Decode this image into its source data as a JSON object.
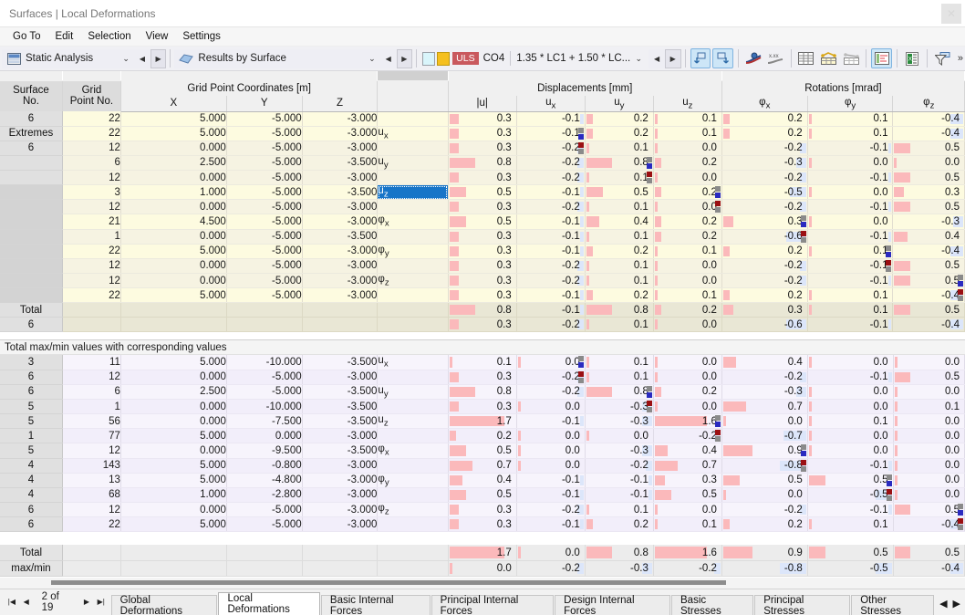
{
  "window": {
    "title": "Surfaces | Local Deformations",
    "close_label": "✕"
  },
  "menu": {
    "items": [
      {
        "label": "Go To"
      },
      {
        "label": "Edit"
      },
      {
        "label": "Selection"
      },
      {
        "label": "View"
      },
      {
        "label": "Settings"
      }
    ]
  },
  "toolbar": {
    "analysis_combo": {
      "value": "Static Analysis",
      "icon": "analysis-icon",
      "chevron": "⌄"
    },
    "results_combo": {
      "value": "Results by Surface",
      "icon": "surface-icon",
      "chevron": "⌄"
    },
    "prev_label": "◀",
    "next_label": "▶",
    "load_case": {
      "badge": "ULS",
      "code": "CO4",
      "formula": "1.35 * LC1 + 1.50 * LC...",
      "chevron": "⌄"
    },
    "buttons": [
      {
        "name": "rotate-left-button",
        "active": true
      },
      {
        "name": "rotate-right-button",
        "active": true
      },
      {
        "name": "result-diagram-button",
        "active": false
      },
      {
        "name": "numeric-values-button",
        "active": false
      },
      {
        "name": "table-view-button",
        "active": false
      },
      {
        "name": "table-highlight-button",
        "active": false
      },
      {
        "name": "table-plain-button",
        "active": false
      },
      {
        "name": "color-bars-button",
        "active": true
      },
      {
        "name": "export-excel-button",
        "active": false
      },
      {
        "name": "filter-button",
        "active": false
      }
    ],
    "overflow_label": "»"
  },
  "table": {
    "group_headers": [
      {
        "label": "",
        "span": 1
      },
      {
        "label": "",
        "span": 1
      },
      {
        "label": "Grid Point Coordinates [m]",
        "span": 3
      },
      {
        "label": "",
        "span": 1
      },
      {
        "label": "Displacements [mm]",
        "span": 4
      },
      {
        "label": "Rotations [mrad]",
        "span": 3
      }
    ],
    "columns": [
      {
        "key": "surface_no",
        "label_line1": "Surface",
        "label_line2": "No."
      },
      {
        "key": "grid_point_no",
        "label_line1": "Grid",
        "label_line2": "Point No."
      },
      {
        "key": "x",
        "label_line1": "",
        "label_line2": "X"
      },
      {
        "key": "y",
        "label_line1": "",
        "label_line2": "Y"
      },
      {
        "key": "z",
        "label_line1": "",
        "label_line2": "Z"
      },
      {
        "key": "symbol",
        "label_line1": "",
        "label_line2": ""
      },
      {
        "key": "u_abs",
        "label_line1": "",
        "label_line2": "|u|"
      },
      {
        "key": "ux",
        "label_line1": "",
        "label_line2": "u_x"
      },
      {
        "key": "uy",
        "label_line1": "",
        "label_line2": "u_y"
      },
      {
        "key": "uz",
        "label_line1": "",
        "label_line2": "u_z"
      },
      {
        "key": "phix",
        "label_line1": "",
        "label_line2": "φ_x"
      },
      {
        "key": "phiy",
        "label_line1": "",
        "label_line2": "φ_y"
      },
      {
        "key": "phiz",
        "label_line1": "",
        "label_line2": "φ_z"
      }
    ],
    "upper_row_header": {
      "line1": "6",
      "line2": "Extremes",
      "line3": "6"
    },
    "upper_rows": [
      {
        "rowhdr": "6",
        "grid": "22",
        "x": "5.000",
        "y": "-5.000",
        "z": "-3.000",
        "sym": "",
        "u_abs": "0.3",
        "ux": "-0.1",
        "uy": "0.2",
        "uz": "0.1",
        "phix": "0.2",
        "phiy": "0.1",
        "phiz": "-0.4",
        "tint": "A"
      },
      {
        "rowhdr": "Extremes",
        "grid": "22",
        "x": "5.000",
        "y": "-5.000",
        "z": "-3.000",
        "sym": "u_x",
        "u_abs": "0.3",
        "ux": "-0.1",
        "uy": "0.2",
        "uz": "0.1",
        "phix": "0.2",
        "phiy": "0.1",
        "phiz": "-0.4",
        "tint": "A"
      },
      {
        "rowhdr": "6",
        "grid": "12",
        "x": "0.000",
        "y": "-5.000",
        "z": "-3.000",
        "sym": "",
        "u_abs": "0.3",
        "ux": "-0.2",
        "uy": "0.1",
        "uz": "0.0",
        "phix": "-0.2",
        "phiy": "-0.1",
        "phiz": "0.5",
        "tint": "B"
      },
      {
        "rowhdr": "",
        "grid": "6",
        "x": "2.500",
        "y": "-5.000",
        "z": "-3.500",
        "sym": "u_y",
        "u_abs": "0.8",
        "ux": "-0.2",
        "uy": "0.8",
        "uz": "0.2",
        "phix": "-0.3",
        "phiy": "0.0",
        "phiz": "0.0",
        "tint": "B"
      },
      {
        "rowhdr": "",
        "grid": "12",
        "x": "0.000",
        "y": "-5.000",
        "z": "-3.000",
        "sym": "",
        "u_abs": "0.3",
        "ux": "-0.2",
        "uy": "0.1",
        "uz": "0.0",
        "phix": "-0.2",
        "phiy": "-0.1",
        "phiz": "0.5",
        "tint": "B"
      },
      {
        "rowhdr": "",
        "grid": "3",
        "x": "1.000",
        "y": "-5.000",
        "z": "-3.500",
        "sym": "u_z",
        "u_abs": "0.5",
        "ux": "-0.1",
        "uy": "0.5",
        "uz": "0.2",
        "phix": "-0.5",
        "phiy": "0.0",
        "phiz": "0.3",
        "tint": "A",
        "selected": true
      },
      {
        "rowhdr": "",
        "grid": "12",
        "x": "0.000",
        "y": "-5.000",
        "z": "-3.000",
        "sym": "",
        "u_abs": "0.3",
        "ux": "-0.2",
        "uy": "0.1",
        "uz": "0.0",
        "phix": "-0.2",
        "phiy": "-0.1",
        "phiz": "0.5",
        "tint": "B"
      },
      {
        "rowhdr": "",
        "grid": "21",
        "x": "4.500",
        "y": "-5.000",
        "z": "-3.000",
        "sym": "φ_x",
        "u_abs": "0.5",
        "ux": "-0.1",
        "uy": "0.4",
        "uz": "0.2",
        "phix": "0.3",
        "phiy": "0.0",
        "phiz": "-0.3",
        "tint": "A"
      },
      {
        "rowhdr": "",
        "grid": "1",
        "x": "0.000",
        "y": "-5.000",
        "z": "-3.500",
        "sym": "",
        "u_abs": "0.3",
        "ux": "-0.1",
        "uy": "0.1",
        "uz": "0.2",
        "phix": "-0.6",
        "phiy": "-0.1",
        "phiz": "0.4",
        "tint": "B"
      },
      {
        "rowhdr": "",
        "grid": "22",
        "x": "5.000",
        "y": "-5.000",
        "z": "-3.000",
        "sym": "φ_y",
        "u_abs": "0.3",
        "ux": "-0.1",
        "uy": "0.2",
        "uz": "0.1",
        "phix": "0.2",
        "phiy": "0.1",
        "phiz": "-0.4",
        "tint": "A"
      },
      {
        "rowhdr": "",
        "grid": "12",
        "x": "0.000",
        "y": "-5.000",
        "z": "-3.000",
        "sym": "",
        "u_abs": "0.3",
        "ux": "-0.2",
        "uy": "0.1",
        "uz": "0.0",
        "phix": "-0.2",
        "phiy": "-0.1",
        "phiz": "0.5",
        "tint": "B"
      },
      {
        "rowhdr": "",
        "grid": "12",
        "x": "0.000",
        "y": "-5.000",
        "z": "-3.000",
        "sym": "φ_z",
        "u_abs": "0.3",
        "ux": "-0.2",
        "uy": "0.1",
        "uz": "0.0",
        "phix": "-0.2",
        "phiy": "-0.1",
        "phiz": "0.5",
        "tint": "B"
      },
      {
        "rowhdr": "",
        "grid": "22",
        "x": "5.000",
        "y": "-5.000",
        "z": "-3.000",
        "sym": "",
        "u_abs": "0.3",
        "ux": "-0.1",
        "uy": "0.2",
        "uz": "0.1",
        "phix": "0.2",
        "phiy": "0.1",
        "phiz": "-0.4",
        "tint": "A"
      }
    ],
    "upper_totals": {
      "label_line1": "Total",
      "label_line2": "6",
      "max": {
        "u_abs": "0.8",
        "ux": "-0.1",
        "uy": "0.8",
        "uz": "0.2",
        "phix": "0.3",
        "phiy": "0.1",
        "phiz": "0.5"
      },
      "min": {
        "u_abs": "0.3",
        "ux": "-0.2",
        "uy": "0.1",
        "uz": "0.0",
        "phix": "-0.6",
        "phiy": "-0.1",
        "phiz": "-0.4"
      }
    },
    "lower_caption": "Total max/min values with corresponding values",
    "lower_rows": [
      {
        "rowhdr": "3",
        "grid": "11",
        "x": "5.000",
        "y": "-10.000",
        "z": "-3.500",
        "sym": "u_x",
        "u_abs": "0.1",
        "ux": "0.0",
        "uy": "0.1",
        "uz": "0.0",
        "phix": "0.4",
        "phiy": "0.0",
        "phiz": "0.0"
      },
      {
        "rowhdr": "6",
        "grid": "12",
        "x": "0.000",
        "y": "-5.000",
        "z": "-3.000",
        "sym": "",
        "u_abs": "0.3",
        "ux": "-0.2",
        "uy": "0.1",
        "uz": "0.0",
        "phix": "-0.2",
        "phiy": "-0.1",
        "phiz": "0.5"
      },
      {
        "rowhdr": "6",
        "grid": "6",
        "x": "2.500",
        "y": "-5.000",
        "z": "-3.500",
        "sym": "u_y",
        "u_abs": "0.8",
        "ux": "-0.2",
        "uy": "0.8",
        "uz": "0.2",
        "phix": "-0.3",
        "phiy": "0.0",
        "phiz": "0.0"
      },
      {
        "rowhdr": "5",
        "grid": "1",
        "x": "0.000",
        "y": "-10.000",
        "z": "-3.500",
        "sym": "",
        "u_abs": "0.3",
        "ux": "0.0",
        "uy": "-0.3",
        "uz": "0.0",
        "phix": "0.7",
        "phiy": "0.0",
        "phiz": "0.1"
      },
      {
        "rowhdr": "5",
        "grid": "56",
        "x": "0.000",
        "y": "-7.500",
        "z": "-3.500",
        "sym": "u_z",
        "u_abs": "1.7",
        "ux": "-0.1",
        "uy": "-0.3",
        "uz": "1.6",
        "phix": "0.0",
        "phiy": "0.1",
        "phiz": "0.0"
      },
      {
        "rowhdr": "1",
        "grid": "77",
        "x": "5.000",
        "y": "0.000",
        "z": "-3.000",
        "sym": "",
        "u_abs": "0.2",
        "ux": "0.0",
        "uy": "0.0",
        "uz": "-0.2",
        "phix": "-0.7",
        "phiy": "0.0",
        "phiz": "0.0"
      },
      {
        "rowhdr": "5",
        "grid": "12",
        "x": "0.000",
        "y": "-9.500",
        "z": "-3.500",
        "sym": "φ_x",
        "u_abs": "0.5",
        "ux": "0.0",
        "uy": "-0.3",
        "uz": "0.4",
        "phix": "0.9",
        "phiy": "0.0",
        "phiz": "0.0"
      },
      {
        "rowhdr": "4",
        "grid": "143",
        "x": "5.000",
        "y": "-0.800",
        "z": "-3.000",
        "sym": "",
        "u_abs": "0.7",
        "ux": "0.0",
        "uy": "-0.2",
        "uz": "0.7",
        "phix": "-0.8",
        "phiy": "-0.1",
        "phiz": "0.0"
      },
      {
        "rowhdr": "4",
        "grid": "13",
        "x": "5.000",
        "y": "-4.800",
        "z": "-3.000",
        "sym": "φ_y",
        "u_abs": "0.4",
        "ux": "-0.1",
        "uy": "-0.1",
        "uz": "0.3",
        "phix": "0.5",
        "phiy": "0.5",
        "phiz": "0.0"
      },
      {
        "rowhdr": "4",
        "grid": "68",
        "x": "1.000",
        "y": "-2.800",
        "z": "-3.000",
        "sym": "",
        "u_abs": "0.5",
        "ux": "-0.1",
        "uy": "-0.1",
        "uz": "0.5",
        "phix": "0.0",
        "phiy": "-0.5",
        "phiz": "0.0"
      },
      {
        "rowhdr": "6",
        "grid": "12",
        "x": "0.000",
        "y": "-5.000",
        "z": "-3.000",
        "sym": "φ_z",
        "u_abs": "0.3",
        "ux": "-0.2",
        "uy": "0.1",
        "uz": "0.0",
        "phix": "-0.2",
        "phiy": "-0.1",
        "phiz": "0.5"
      },
      {
        "rowhdr": "6",
        "grid": "22",
        "x": "5.000",
        "y": "-5.000",
        "z": "-3.000",
        "sym": "",
        "u_abs": "0.3",
        "ux": "-0.1",
        "uy": "0.2",
        "uz": "0.1",
        "phix": "0.2",
        "phiy": "0.1",
        "phiz": "-0.4"
      }
    ],
    "grand_totals": {
      "label_line1": "Total",
      "label_line2": "max/min",
      "max": {
        "u_abs": "1.7",
        "ux": "0.0",
        "uy": "0.8",
        "uz": "1.6",
        "phix": "0.9",
        "phiy": "0.5",
        "phiz": "0.5"
      },
      "min": {
        "u_abs": "0.0",
        "ux": "-0.2",
        "uy": "-0.3",
        "uz": "-0.2",
        "phix": "-0.8",
        "phiy": "-0.5",
        "phiz": "-0.4"
      }
    }
  },
  "footer": {
    "pager": {
      "first": "|◀",
      "prev": "◀",
      "info": "2 of 19",
      "next": "▶",
      "last": "▶|"
    },
    "tabs": [
      {
        "label": "Global Deformations",
        "active": false
      },
      {
        "label": "Local Deformations",
        "active": true
      },
      {
        "label": "Basic Internal Forces",
        "active": false
      },
      {
        "label": "Principal Internal Forces",
        "active": false
      },
      {
        "label": "Design Internal Forces",
        "active": false
      },
      {
        "label": "Basic Stresses",
        "active": false
      },
      {
        "label": "Principal Stresses",
        "active": false
      },
      {
        "label": "Other Stresses",
        "active": false
      }
    ],
    "tab_prev": "◀",
    "tab_next": "▶"
  },
  "colors": {
    "positive_bar": "#fbb9bb",
    "negative_bar": "#dce6fa",
    "selection": "#1775c8",
    "uls_badge": "#c9595e",
    "accent_toolbar": "#cde6f7"
  }
}
